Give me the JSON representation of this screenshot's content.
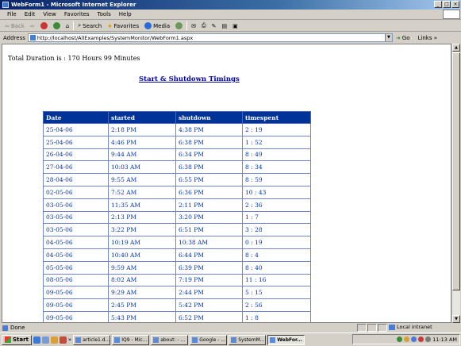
{
  "window": {
    "title": "WebForm1 - Microsoft Internet Explorer"
  },
  "menu": [
    "File",
    "Edit",
    "View",
    "Favorites",
    "Tools",
    "Help"
  ],
  "toolbar": {
    "back": "Back",
    "search": "Search",
    "favorites": "Favorites",
    "media": "Media"
  },
  "address": {
    "label": "Address",
    "url": "http://localhost/AllExamples/SystemMonitor/WebForm1.aspx",
    "go": "Go",
    "links": "Links"
  },
  "page": {
    "total_duration": "Total Duration is : 170 Hours 99 Minutes",
    "heading": "Start & Shutdown Timings",
    "table": {
      "headers": [
        "Date",
        "started",
        "shutdown",
        "timespent"
      ],
      "rows": [
        [
          "25-04-06",
          "2:18 PM",
          "4:38 PM",
          "2 : 19"
        ],
        [
          "25-04-06",
          "4:46 PM",
          "6:38 PM",
          "1 : 52"
        ],
        [
          "26-04-06",
          "9:44 AM",
          "6:34 PM",
          "8 : 49"
        ],
        [
          "27-04-06",
          "10:03 AM",
          "6:38 PM",
          "8 : 34"
        ],
        [
          "28-04-06",
          "9:55 AM",
          "6:55 PM",
          "8 : 59"
        ],
        [
          "02-05-06",
          "7:52 AM",
          "6:36 PM",
          "10 : 43"
        ],
        [
          "03-05-06",
          "11:35 AM",
          "2:11 PM",
          "2 : 36"
        ],
        [
          "03-05-06",
          "2:13 PM",
          "3:20 PM",
          "1 : 7"
        ],
        [
          "03-05-06",
          "3:22 PM",
          "6:51 PM",
          "3 : 28"
        ],
        [
          "04-05-06",
          "10:19 AM",
          "10:38 AM",
          "0 : 19"
        ],
        [
          "04-05-06",
          "10:40 AM",
          "6:44 PM",
          "8 : 4"
        ],
        [
          "05-05-06",
          "9:59 AM",
          "6:39 PM",
          "8 : 40"
        ],
        [
          "08-05-06",
          "8:02 AM",
          "7:19 PM",
          "11 : 16"
        ],
        [
          "09-05-06",
          "9:29 AM",
          "2:44 PM",
          "5 : 15"
        ],
        [
          "09-05-06",
          "2:45 PM",
          "5:42 PM",
          "2 : 56"
        ],
        [
          "09-05-06",
          "5:43 PM",
          "6:52 PM",
          "1 : 8"
        ]
      ]
    }
  },
  "status": {
    "text": "Done",
    "zone": "Local intranet"
  },
  "taskbar": {
    "start": "Start",
    "tasks": [
      "article1.d...",
      "IQ9 - Mic...",
      "about: - ...",
      "Google - ...",
      "SystemM...",
      "WebFor..."
    ],
    "active_index": 5,
    "clock": "11:13 AM"
  }
}
